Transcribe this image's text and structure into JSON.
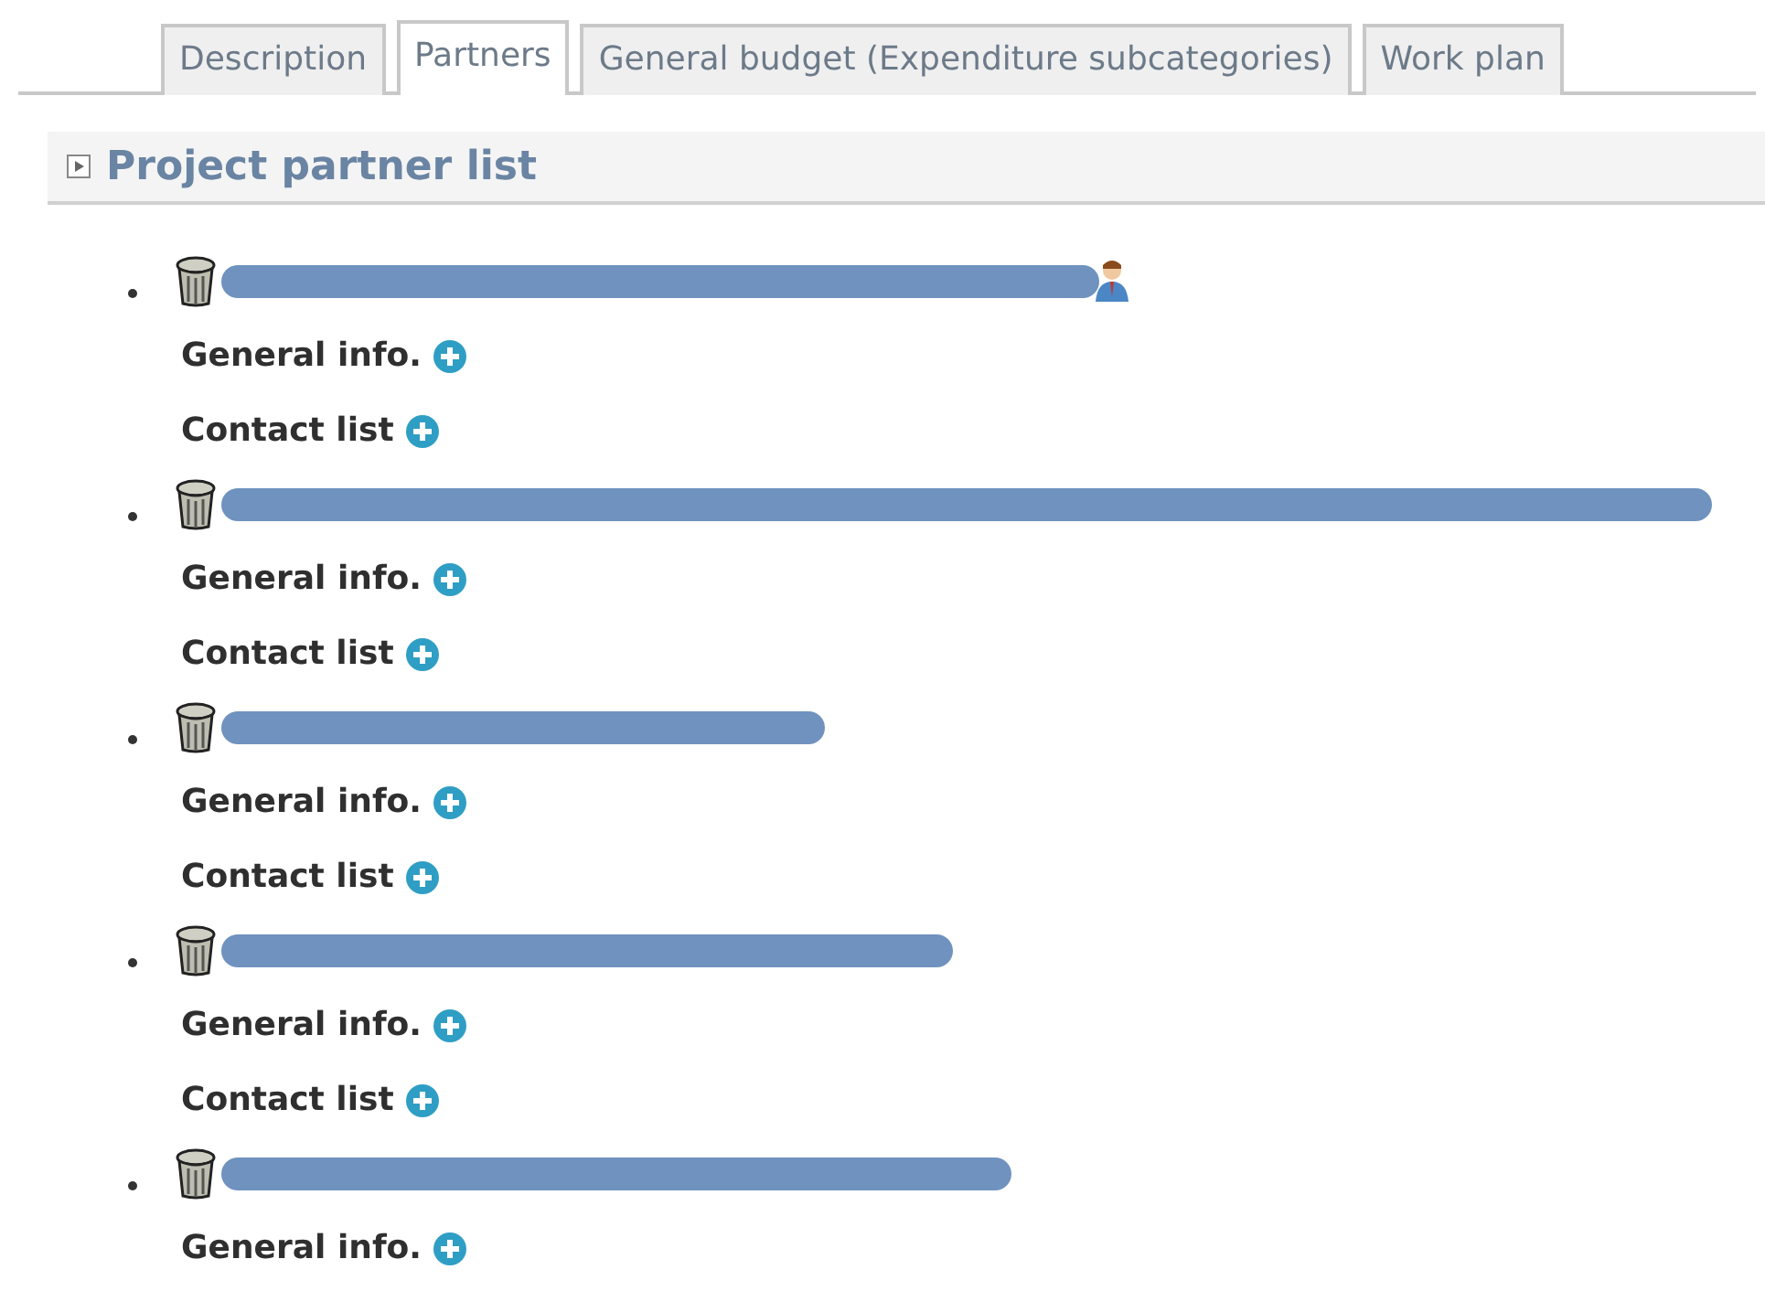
{
  "tabs": [
    {
      "label": "Description",
      "selected": false
    },
    {
      "label": "Partners",
      "selected": true
    },
    {
      "label": "General budget (Expenditure subcategories)",
      "selected": false
    },
    {
      "label": "Work plan",
      "selected": false
    }
  ],
  "section": {
    "title": "Project partner list",
    "expanded": true
  },
  "partners": [
    {
      "person_icon": true,
      "sections": [
        "General info.",
        "Contact list"
      ]
    },
    {
      "person_icon": false,
      "sections": [
        "General info.",
        "Contact list"
      ]
    },
    {
      "person_icon": false,
      "sections": [
        "General info.",
        "Contact list"
      ]
    },
    {
      "person_icon": false,
      "sections": [
        "General info.",
        "Contact list"
      ]
    },
    {
      "person_icon": false,
      "sections": [
        "General info."
      ]
    }
  ]
}
